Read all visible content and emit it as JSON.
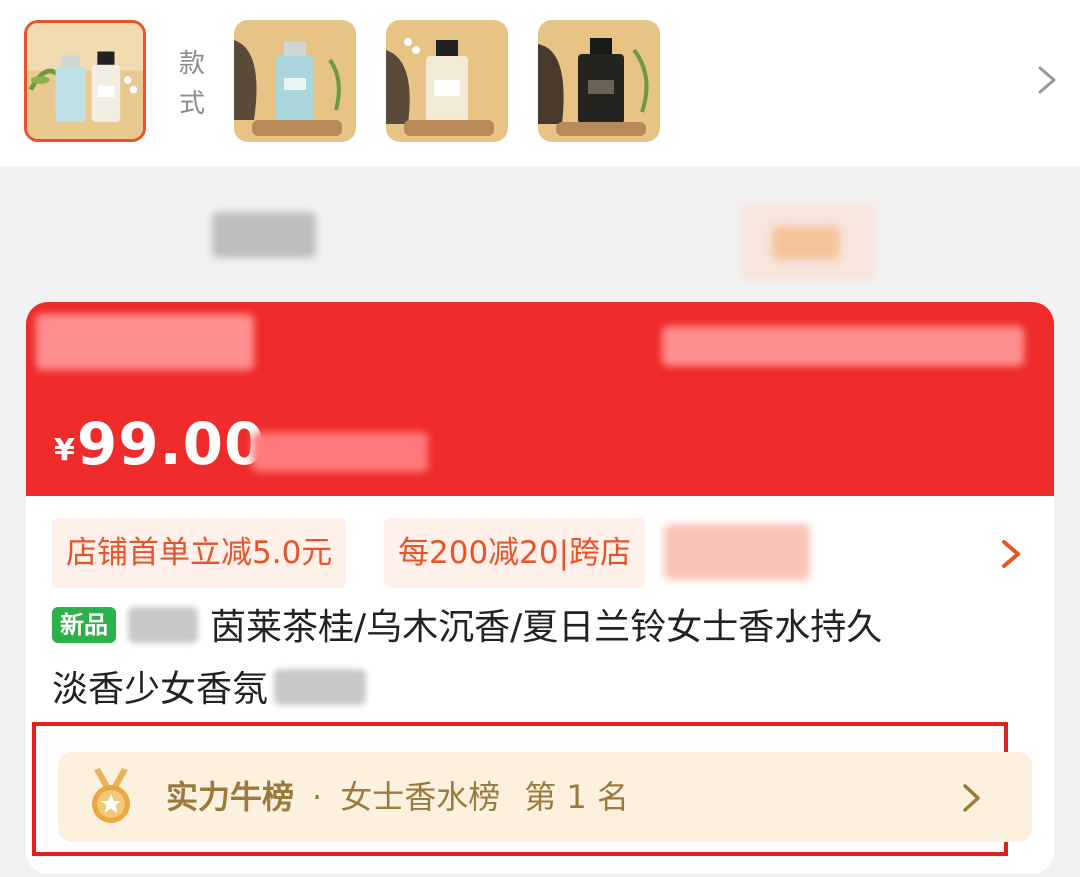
{
  "style_selector": {
    "label": "款式",
    "thumbnails": [
      {
        "name": "thumbnail-variant-set",
        "selected": true
      },
      {
        "name": "thumbnail-variant-blue",
        "selected": false
      },
      {
        "name": "thumbnail-variant-clear",
        "selected": false
      },
      {
        "name": "thumbnail-variant-dark",
        "selected": false
      }
    ],
    "more_icon": "chevron-right-icon"
  },
  "price_banner": {
    "currency_symbol": "¥",
    "price": "99.00",
    "color": "#ef2b2b"
  },
  "coupons": [
    {
      "label": "店铺首单立减5.0元"
    },
    {
      "label": "每200减20|跨店"
    }
  ],
  "product": {
    "badge": "新品",
    "title_line1": "茵莱茶桂/乌木沉香/夏日兰铃女士香水持久",
    "title_line2": "淡香少女香氛"
  },
  "ranking": {
    "category": "实力牛榜",
    "separator": "·",
    "list_name": "女士香水榜",
    "rank": "第 1 名",
    "icon": "medal-icon"
  },
  "colors": {
    "accent": "#e8542a",
    "highlight_border": "#e0211e",
    "new_badge": "#2bb04a",
    "rank_text": "#9c7a3c"
  }
}
